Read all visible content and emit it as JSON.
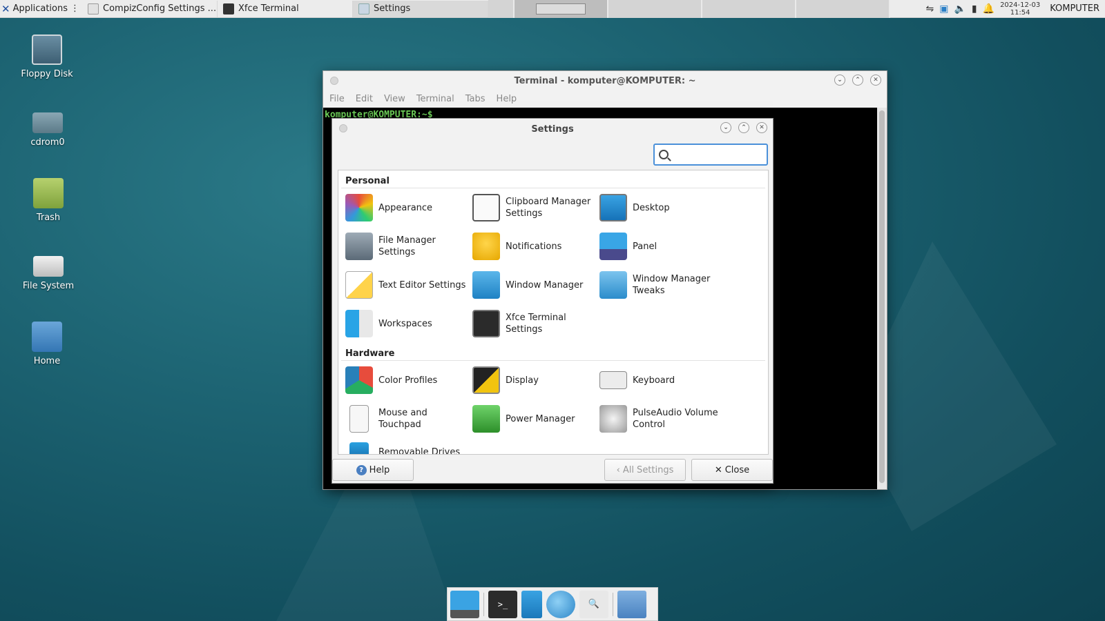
{
  "top_panel": {
    "applications_label": "Applications",
    "tasks": [
      {
        "label": "CompizConfig Settings ...",
        "icon": "compiz-settings-icon"
      },
      {
        "label": "Xfce Terminal",
        "icon": "terminal-icon"
      },
      {
        "label": "Settings",
        "icon": "settings-icon"
      }
    ],
    "clock_date": "2024-12-03",
    "clock_time": "11:54",
    "username": "KOMPUTER"
  },
  "desktop_icons": [
    {
      "label": "Floppy Disk",
      "icon": "floppy-icon"
    },
    {
      "label": "cdrom0",
      "icon": "cdrom-icon"
    },
    {
      "label": "Trash",
      "icon": "trash-icon"
    },
    {
      "label": "File System",
      "icon": "filesystem-icon"
    },
    {
      "label": "Home",
      "icon": "home-icon"
    }
  ],
  "terminal": {
    "title": "Terminal - komputer@KOMPUTER: ~",
    "menu": [
      "File",
      "Edit",
      "View",
      "Terminal",
      "Tabs",
      "Help"
    ],
    "prompt": "komputer@KOMPUTER:~$"
  },
  "settings": {
    "title": "Settings",
    "search_value": "",
    "sections": [
      {
        "title": "Personal",
        "items": [
          "Appearance",
          "Clipboard Manager Settings",
          "Desktop",
          "File Manager Settings",
          "Notifications",
          "Panel",
          "Text Editor Settings",
          "Window Manager",
          "Window Manager Tweaks",
          "Workspaces",
          "Xfce Terminal Settings"
        ]
      },
      {
        "title": "Hardware",
        "items": [
          "Color Profiles",
          "Display",
          "Keyboard",
          "Mouse and Touchpad",
          "Power Manager",
          "PulseAudio Volume Control",
          "Removable Drives"
        ]
      }
    ],
    "buttons": {
      "help": "Help",
      "all_settings": "All Settings",
      "close": "Close"
    }
  },
  "dock": [
    "show-desktop-icon",
    "terminal-icon",
    "files-icon",
    "web-browser-icon",
    "app-finder-icon",
    "folder-icon"
  ]
}
